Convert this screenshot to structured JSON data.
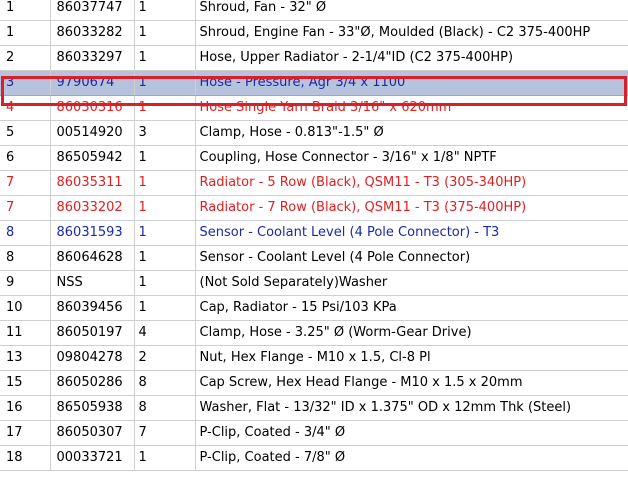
{
  "parts_list": {
    "rows": [
      {
        "ref": "1",
        "part_no": "86037747",
        "qty": "1",
        "description": "Shroud, Fan - 32\" Ø",
        "status": "normal"
      },
      {
        "ref": "1",
        "part_no": "86033282",
        "qty": "1",
        "description": "Shroud, Engine Fan - 33\"Ø, Moulded (Black) - C2 375-400HP",
        "status": "normal"
      },
      {
        "ref": "2",
        "part_no": "86033297",
        "qty": "1",
        "description": "Hose, Upper Radiator - 2-1/4\"ID (C2 375-400HP)",
        "status": "normal"
      },
      {
        "ref": "3",
        "part_no": "9790674",
        "qty": "1",
        "description": "Hose - Pressure, Agr 3/4 x 1100",
        "status": "selected"
      },
      {
        "ref": "4",
        "part_no": "86030316",
        "qty": "1",
        "description": "Hose Single Yarn Braid 3/16\" x 620mm",
        "status": "red"
      },
      {
        "ref": "5",
        "part_no": "00514920",
        "qty": "3",
        "description": "Clamp, Hose - 0.813\"-1.5\" Ø",
        "status": "normal"
      },
      {
        "ref": "6",
        "part_no": "86505942",
        "qty": "1",
        "description": "Coupling, Hose Connector - 3/16\" x 1/8\" NPTF",
        "status": "normal"
      },
      {
        "ref": "7",
        "part_no": "86035311",
        "qty": "1",
        "description": "Radiator - 5 Row (Black), QSM11 - T3 (305-340HP)",
        "status": "red"
      },
      {
        "ref": "7",
        "part_no": "86033202",
        "qty": "1",
        "description": "Radiator - 7 Row (Black), QSM11 - T3 (375-400HP)",
        "status": "red"
      },
      {
        "ref": "8",
        "part_no": "86031593",
        "qty": "1",
        "description": "Sensor - Coolant Level (4 Pole Connector) - T3",
        "status": "blue"
      },
      {
        "ref": "8",
        "part_no": "86064628",
        "qty": "1",
        "description": "Sensor - Coolant Level (4 Pole Connector)",
        "status": "normal"
      },
      {
        "ref": "9",
        "part_no": "NSS",
        "qty": "1",
        "description": "(Not Sold Separately)Washer",
        "status": "normal"
      },
      {
        "ref": "10",
        "part_no": "86039456",
        "qty": "1",
        "description": "Cap, Radiator - 15 Psi/103 KPa",
        "status": "normal"
      },
      {
        "ref": "11",
        "part_no": "86050197",
        "qty": "4",
        "description": "Clamp, Hose - 3.25\" Ø (Worm-Gear Drive)",
        "status": "normal"
      },
      {
        "ref": "13",
        "part_no": "09804278",
        "qty": "2",
        "description": "Nut, Hex Flange - M10 x 1.5, Cl-8 Pl",
        "status": "normal"
      },
      {
        "ref": "15",
        "part_no": "86050286",
        "qty": "8",
        "description": "Cap Screw, Hex Head Flange - M10 x 1.5 x 20mm",
        "status": "normal"
      },
      {
        "ref": "16",
        "part_no": "86505938",
        "qty": "8",
        "description": "Washer, Flat - 13/32\" ID x 1.375\" OD x 12mm Thk (Steel)",
        "status": "normal"
      },
      {
        "ref": "17",
        "part_no": "86050307",
        "qty": "7",
        "description": "P-Clip, Coated - 3/4\" Ø",
        "status": "normal"
      },
      {
        "ref": "18",
        "part_no": "00033721",
        "qty": "1",
        "description": "P-Clip, Coated - 7/8\" Ø",
        "status": "normal"
      }
    ],
    "colors": {
      "highlight_bg": "#b7c3dd",
      "highlight_outline": "#d9202a",
      "red_text": "#e02020",
      "blue_text": "#1a2aa8"
    }
  }
}
